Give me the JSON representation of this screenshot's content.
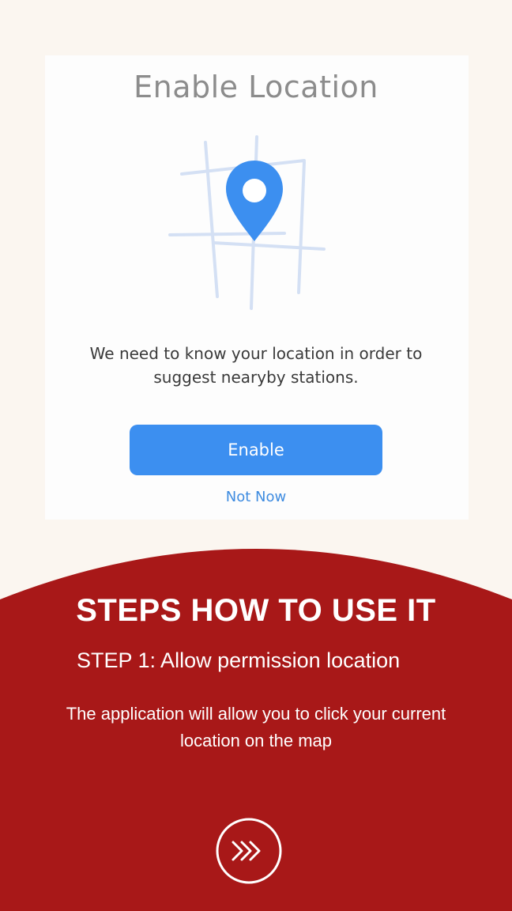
{
  "dialog": {
    "title": "Enable Location",
    "illustration_icon": "map-pin-icon",
    "message": "We need to know your location in order to suggest nearyby stations.",
    "enable_label": "Enable",
    "not_now_label": "Not Now",
    "accent_color": "#3c8ff0"
  },
  "steps_panel": {
    "heading": "STEPS HOW TO USE IT",
    "step": "STEP 1:  Allow permission location",
    "description": "The application will allow you to click your current location on the map",
    "next_icon": "triple-chevron-right-icon",
    "background_color": "#a81818"
  }
}
